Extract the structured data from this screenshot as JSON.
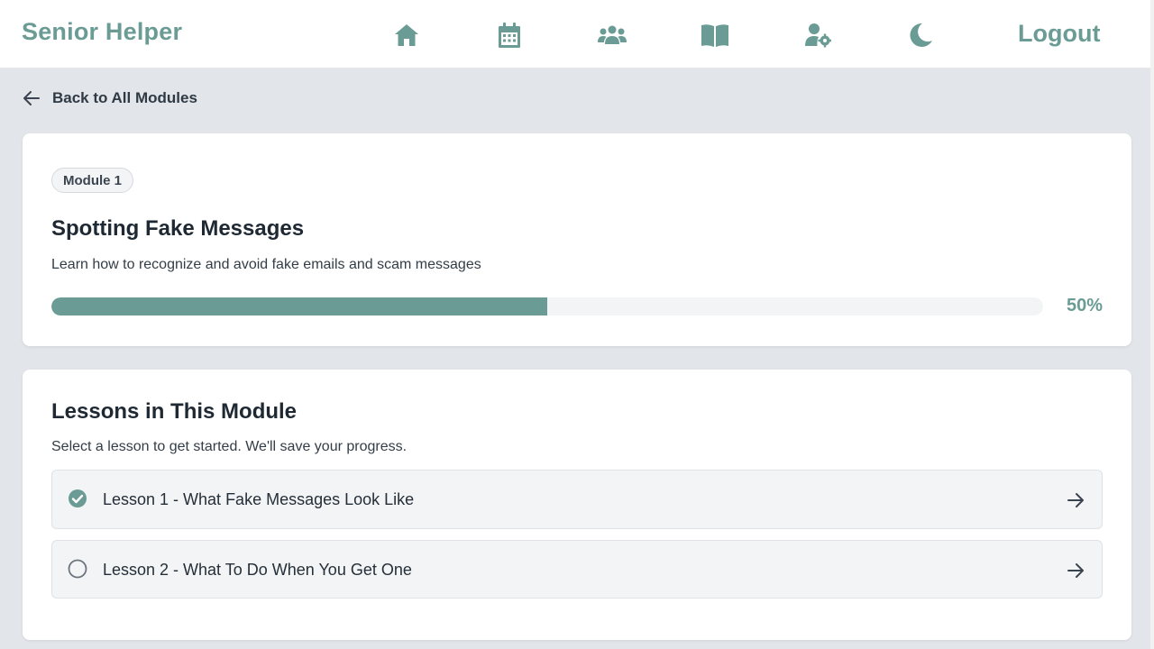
{
  "app": {
    "brand": "Senior Helper",
    "logout_label": "Logout",
    "accent_color": "#6a9c95"
  },
  "nav": {
    "icons": [
      "home-icon",
      "calendar-icon",
      "community-icon",
      "learning-icon",
      "account-settings-icon",
      "dark-mode-icon"
    ]
  },
  "back": {
    "label": "Back to All Modules"
  },
  "module": {
    "badge": "Module 1",
    "title": "Spotting Fake Messages",
    "description": "Learn how to recognize and avoid fake emails and scam messages",
    "progress_percent": 50,
    "progress_label": "50%"
  },
  "lessons": {
    "title": "Lessons in This Module",
    "subtitle": "Select a lesson to get started. We'll save your progress.",
    "items": [
      {
        "label": "Lesson 1 - What Fake Messages Look Like",
        "completed": true
      },
      {
        "label": "Lesson 2 - What To Do When You Get One",
        "completed": false
      }
    ]
  }
}
